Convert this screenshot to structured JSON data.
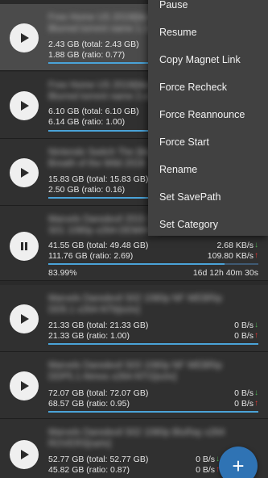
{
  "torrents": [
    {
      "title_line1": "Free Home US 2019(blurred title)",
      "title_line2": "Blurred torrent name 1.1080p",
      "size_line": "2.43 GB (total: 2.43 GB)",
      "upload_line": "1.88 GB (ratio: 0.77)",
      "state_icon": "play-icon",
      "progress": 1.0
    },
    {
      "title_line1": "Free Home US 2019(blurred title)",
      "title_line2": "Blurred torrent name 2.x264",
      "size_line": "6.10 GB (total: 6.10 GB)",
      "upload_line": "6.14 GB (ratio: 1.00)",
      "state_icon": "play-icon",
      "progress": 1.0
    },
    {
      "title_line1": "Nintendo Switch The (blurred)",
      "title_line2": "Breath of the Wild 2019",
      "size_line": "15.83 GB (total: 15.83 GB)",
      "upload_line": "2.50 GB (ratio: 0.16)",
      "state_icon": "play-icon",
      "progress": 1.0
    },
    {
      "title_line1": "Marvels Daredevil 2015 (blurred)",
      "title_line2": "S01 1080p x264-DEMAND",
      "size_line": "41.55 GB (total: 49.48 GB)",
      "upload_line": "111.76 GB (ratio: 2.69)",
      "down_speed": "2.68 KB/s",
      "up_speed": "109.80 KB/s",
      "percent": "83.99%",
      "eta": "16d 12h 40m 30s",
      "state_icon": "pause-icon",
      "progress": 0.8399
    },
    {
      "title_line1": "Marvels Daredevil S02 1080p NF WEBRip",
      "title_line2": "DD5.1 x264-NTb[eztv]",
      "size_line": "21.33 GB (total: 21.33 GB)",
      "upload_line": "21.33 GB (ratio: 1.00)",
      "down_speed": "0 B/s",
      "up_speed": "0 B/s",
      "state_icon": "play-icon",
      "progress": 1.0
    },
    {
      "title_line1": "Marvels Daredevil S03 1080p NF WEBRip",
      "title_line2": "DDP5.1 Atmos x264-NTG[eztv]",
      "size_line": "72.07 GB (total: 72.07 GB)",
      "upload_line": "68.57 GB (ratio: 0.95)",
      "down_speed": "0 B/s",
      "up_speed": "0 B/s",
      "state_icon": "play-icon",
      "progress": 1.0
    },
    {
      "title_line1": "Marvels Daredevil S02 1080p BluRay x264",
      "title_line2": "ROVERS[rartv]",
      "size_line": "52.77 GB (total: 52.77 GB)",
      "upload_line": "45.82 GB (ratio: 0.87)",
      "down_speed": "0 B/s",
      "up_speed": "0 B/s",
      "state_icon": "play-icon",
      "progress": 1.0
    }
  ],
  "context_menu": {
    "items": [
      "Pause",
      "Resume",
      "Copy Magnet Link",
      "Force Recheck",
      "Force Reannounce",
      "Force Start",
      "Rename",
      "Set SavePath",
      "Set Category"
    ]
  },
  "fab": {
    "icon": "plus-icon",
    "label": "+"
  },
  "colors": {
    "accent": "#2f73b4",
    "progress": "#4aa3d8",
    "download_arrow": "#4caf50",
    "upload_arrow": "#e53935"
  }
}
